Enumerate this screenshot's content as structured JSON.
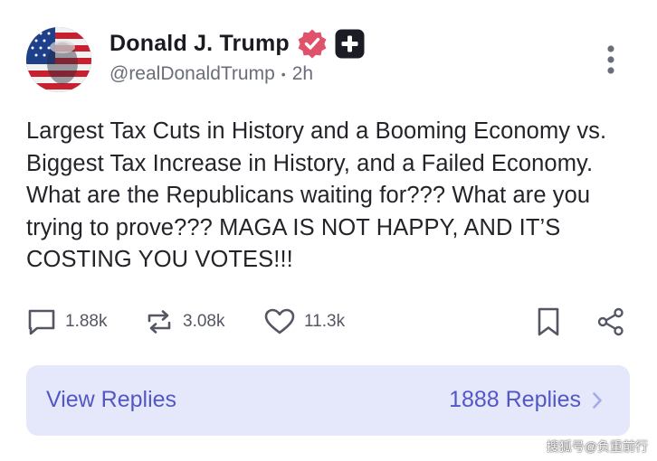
{
  "post": {
    "author_name": "Donald J. Trump",
    "handle": "@realDonaldTrump",
    "separator": "•",
    "time_ago": "2h",
    "text": "Largest Tax Cuts in History and a Booming Economy vs. Biggest Tax Increase in History, and a Failed Economy. What are the Republicans waiting for??? What are you trying to prove??? MAGA IS NOT HAPPY, AND IT’S COSTING YOU VOTES!!!"
  },
  "actions": {
    "replies_count": "1.88k",
    "retruths_count": "3.08k",
    "likes_count": "11.3k"
  },
  "replies_bar": {
    "label": "View Replies",
    "count_label": "1888 Replies"
  },
  "watermark": "搜狐号@负重前行",
  "icons": [
    "verified-icon",
    "plus-badge-icon",
    "more-vertical-icon",
    "comment-icon",
    "retruth-icon",
    "heart-icon",
    "bookmark-icon",
    "share-icon",
    "chevron-right-icon"
  ],
  "colors": {
    "accent": "#5257c5",
    "verified": "#e0516a",
    "bar_bg": "#e5e8fb"
  }
}
